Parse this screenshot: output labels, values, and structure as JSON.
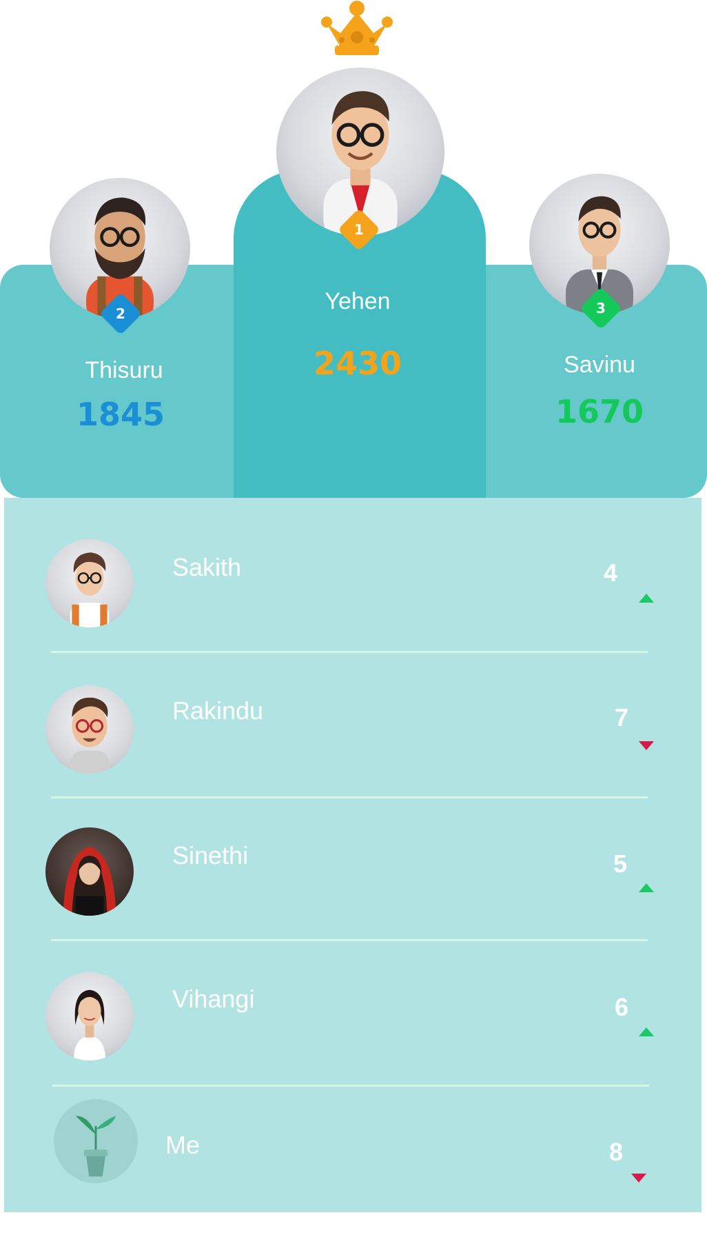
{
  "podium": {
    "first": {
      "rank": "1",
      "name": "Yehen",
      "score": "2430",
      "score_color": "#f4a31a"
    },
    "second": {
      "rank": "2",
      "name": "Thisuru",
      "score": "1845",
      "score_color": "#1a8fd6"
    },
    "third": {
      "rank": "3",
      "name": "Savinu",
      "score": "1670",
      "score_color": "#12c95a"
    }
  },
  "leaderboard": [
    {
      "name": "Sakith",
      "rank": "4",
      "trend": "up"
    },
    {
      "name": "Rakindu",
      "rank": "7",
      "trend": "down"
    },
    {
      "name": "Sinethi",
      "rank": "5",
      "trend": "up"
    },
    {
      "name": "Vihangi",
      "rank": "6",
      "trend": "up"
    },
    {
      "name": "Me",
      "rank": "8",
      "trend": "down"
    }
  ],
  "colors": {
    "crown": "#f4a31a",
    "trend_up": "#18c964",
    "trend_down": "#d61b4a",
    "podium_side": "#65c8ca",
    "podium_center": "#44bdc2",
    "list_bg": "#b1e3e3"
  },
  "icons": {
    "crown": "crown-icon",
    "trend_up": "arrow-up-icon",
    "trend_down": "arrow-down-icon",
    "me_avatar": "plant-icon"
  }
}
